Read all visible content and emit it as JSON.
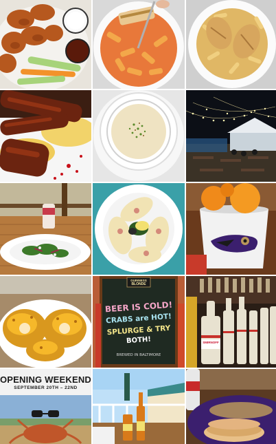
{
  "photos": [
    {
      "name": "wings-with-celery-and-carrots"
    },
    {
      "name": "penne-pasta-with-sauce"
    },
    {
      "name": "penne-pasta-with-chicken"
    },
    {
      "name": "glazed-ribs-on-mashed-potatoes"
    },
    {
      "name": "cream-soup-bowl"
    },
    {
      "name": "patio-with-string-lights"
    },
    {
      "name": "salad-and-seltzer-can-on-patio-table"
    },
    {
      "name": "crab-cakes-on-plate"
    },
    {
      "name": "bucket-of-oranges-with-ravens-logo"
    },
    {
      "name": "cheese-pretzel"
    },
    {
      "name": "chalkboard-sign"
    },
    {
      "name": "liquor-bottles-behind-bar"
    },
    {
      "name": "opening-weekend-promo"
    },
    {
      "name": "beer-bottles-on-deck"
    },
    {
      "name": "sandwich-on-ravens-tray"
    }
  ],
  "chalkboard": {
    "brand_top": "GUINNESS",
    "brand_sub": "BLONDE",
    "line1": "BEER IS COLD!",
    "line2": "CRABS are HOT!",
    "line3": "SPLURGE & TRY",
    "line4": "BOTH!",
    "footer": "BREWED IN BALTIMORE"
  },
  "promo": {
    "title": "OPENING WEEKEND",
    "dates": "SEPTEMBER 20TH – 22ND"
  },
  "bar": {
    "bottle_label": "SMIRNOFF"
  },
  "colors": {
    "ravens_purple": "#3b1f6e",
    "ravens_gold": "#b9975b",
    "orange": "#f08a1a",
    "chalkboard": "#1f2a22"
  }
}
